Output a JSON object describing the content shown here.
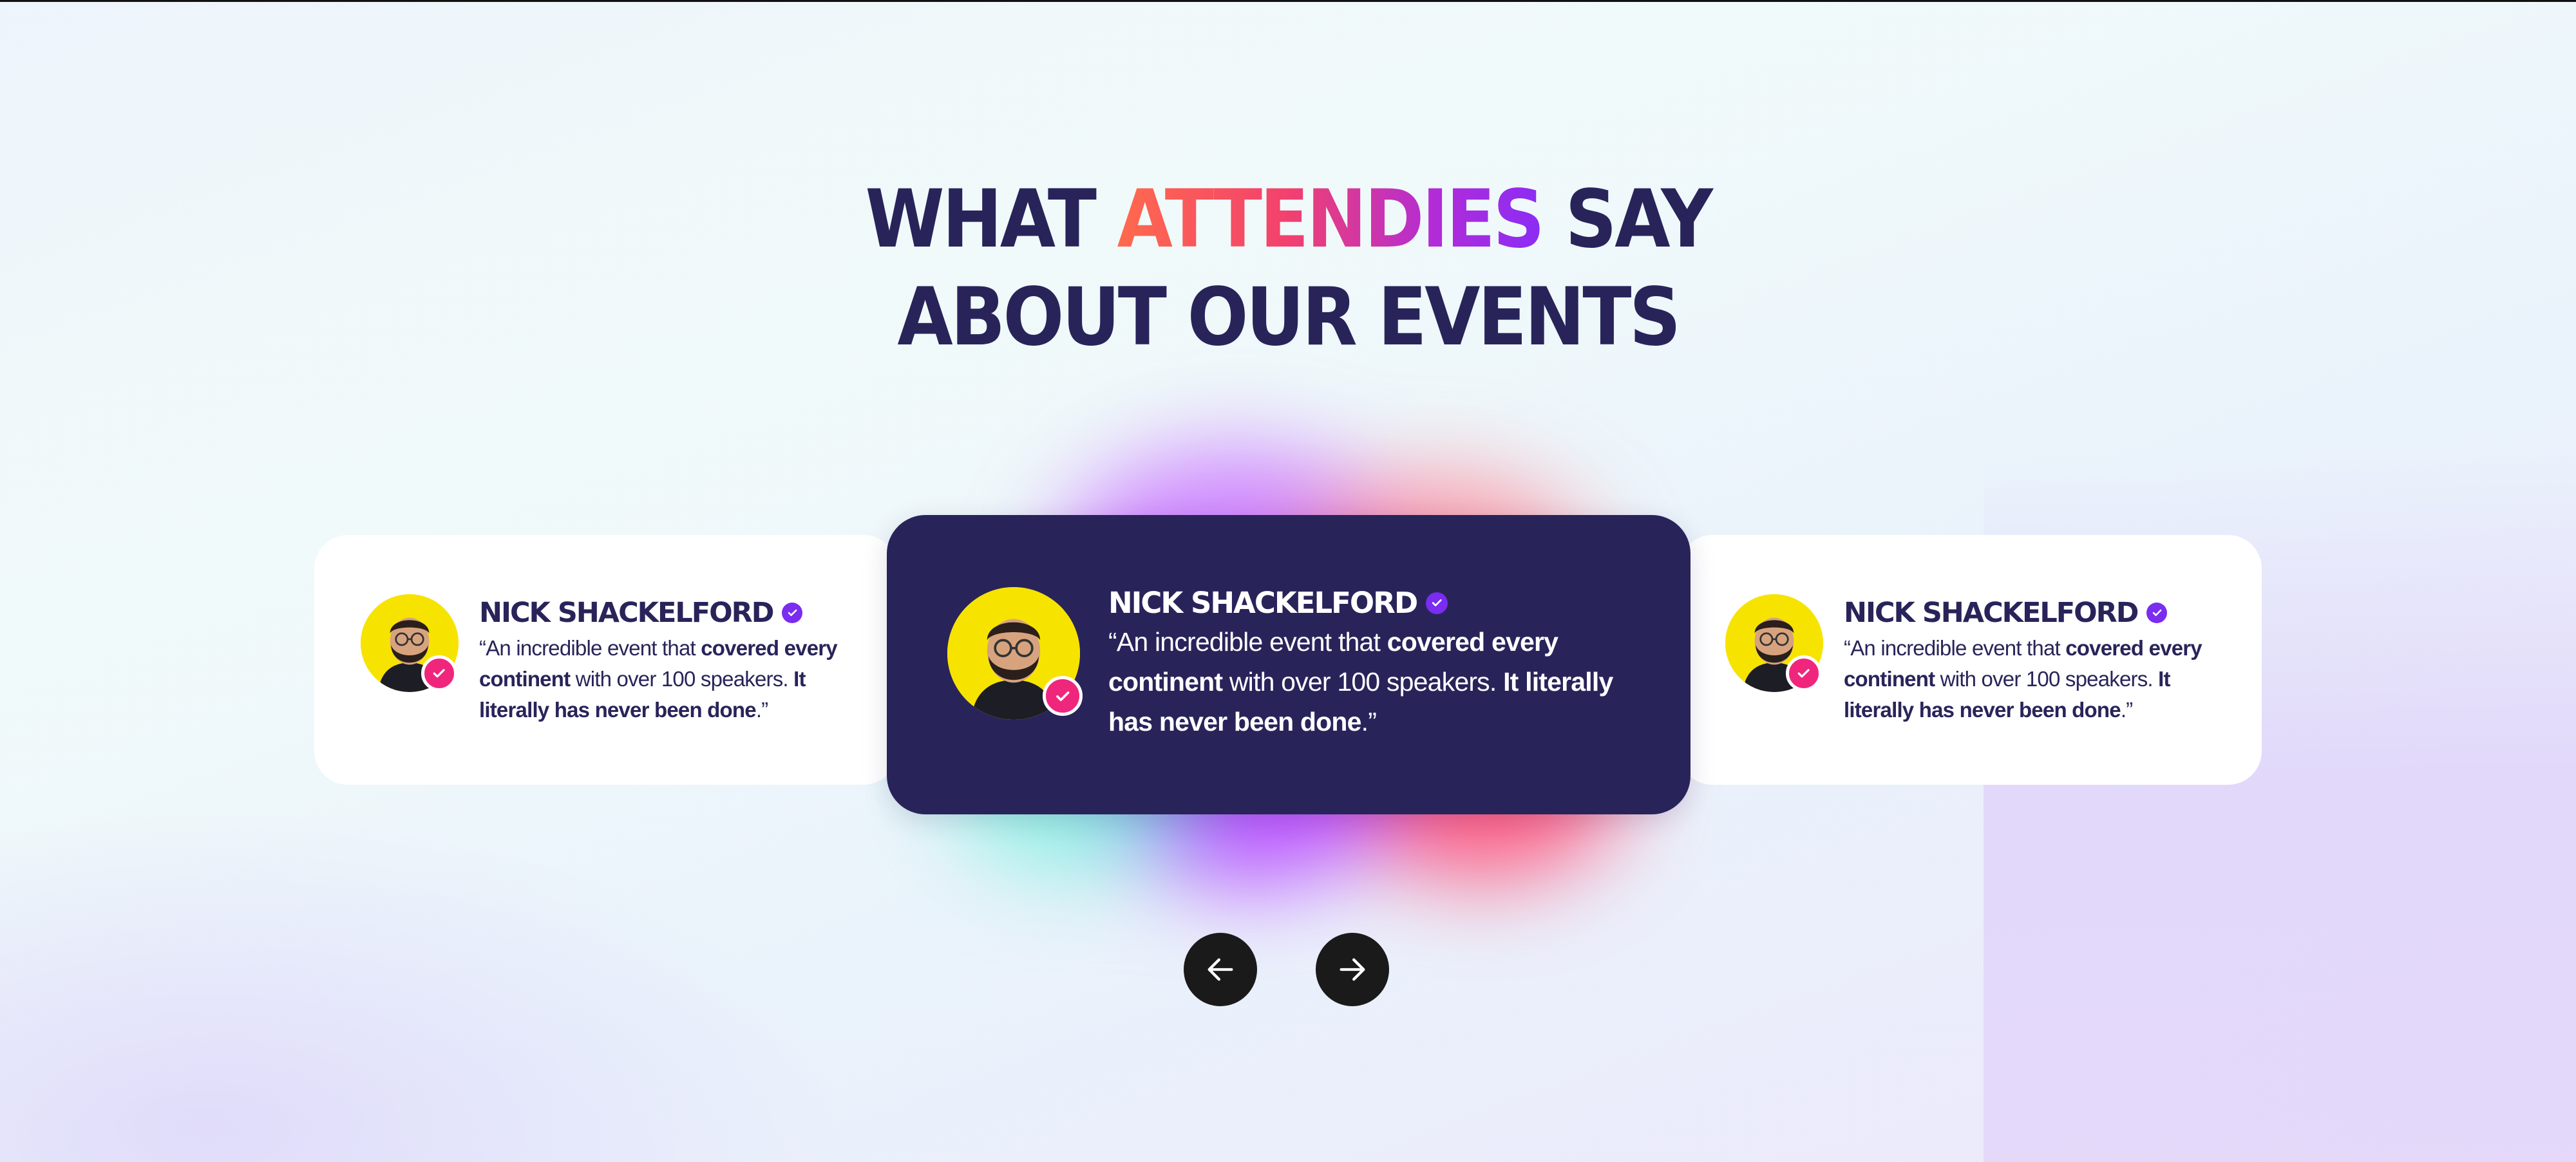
{
  "headline": {
    "line1_before": "WHAT ",
    "line1_accent": "ATTENDIES",
    "line1_after": " SAY",
    "line2": "ABOUT OUR EVENTS"
  },
  "testimonials": [
    {
      "name": "NICK SHACKELFORD",
      "q1": "“An incredible event that ",
      "q2": "covered every continent",
      "q3": " with over 100 speakers. ",
      "q4": "It literally has never been done",
      "q5": ".”"
    },
    {
      "name": "NICK SHACKELFORD",
      "q1": "“An incredible event that ",
      "q2": "covered every continent",
      "q3": " with over 100 speakers. ",
      "q4": "It literally has never been done",
      "q5": ".”"
    },
    {
      "name": "NICK SHACKELFORD",
      "q1": "“An incredible event that ",
      "q2": "covered every continent",
      "q3": " with over 100 speakers. ",
      "q4": "It literally has never been done",
      "q5": ".”"
    }
  ],
  "icons": {
    "verified": "verified-badge-icon",
    "avatar_badge": "check-badge-icon",
    "prev": "arrow-left-icon",
    "next": "arrow-right-icon"
  },
  "colors": {
    "navy": "#28245a",
    "accent_start": "#ff6a4d",
    "accent_end": "#8b2cf5",
    "badge_pink": "#f0267c",
    "verified_purple": "#7a2cf0",
    "avatar_yellow": "#f7e300",
    "nav_button": "#1a1a1a"
  }
}
